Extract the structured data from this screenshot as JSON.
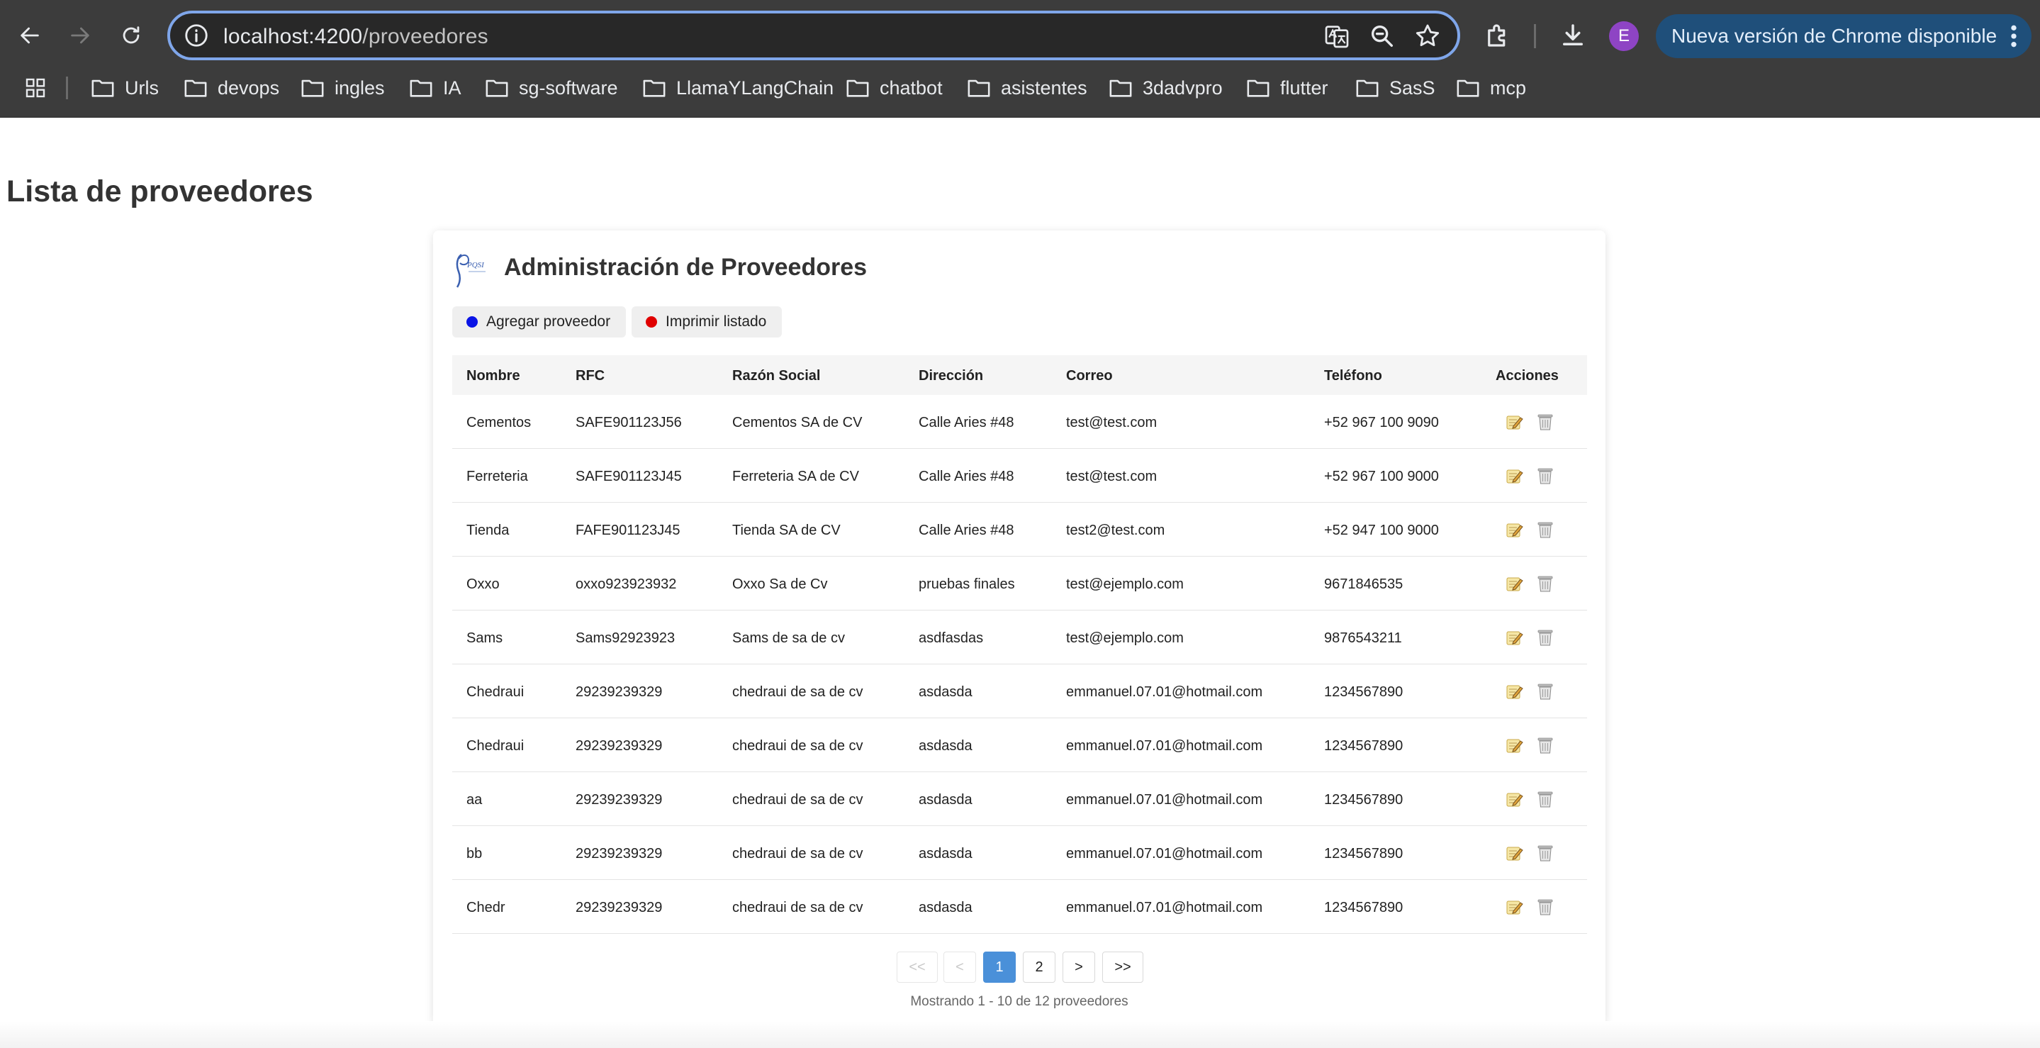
{
  "browser": {
    "url_host": "localhost:4200",
    "url_path": "/proveedores",
    "update_label": "Nueva versión de Chrome disponible",
    "avatar_letter": "E",
    "bookmarks": [
      "Urls",
      "devops",
      "ingles",
      "IA",
      "sg-software",
      "LlamaYLangChain",
      "chatbot",
      "asistentes",
      "3dadvpro",
      "flutter",
      "SasS",
      "mcp"
    ]
  },
  "page": {
    "title": "Lista de proveedores"
  },
  "card": {
    "title": "Administración de Proveedores",
    "logo_text": "PQSI",
    "add_button": "Agregar proveedor",
    "print_button": "Imprimir listado",
    "add_dot_color": "#0a14e6",
    "print_dot_color": "#e00000"
  },
  "table": {
    "headers": [
      "Nombre",
      "RFC",
      "Razón Social",
      "Dirección",
      "Correo",
      "Teléfono",
      "Acciones"
    ],
    "rows": [
      [
        "Cementos",
        "SAFE901123J56",
        "Cementos SA de CV",
        "Calle Aries #48",
        "test@test.com",
        "+52 967 100 9090"
      ],
      [
        "Ferreteria",
        "SAFE901123J45",
        "Ferreteria SA de CV",
        "Calle Aries #48",
        "test@test.com",
        "+52 967 100 9000"
      ],
      [
        "Tienda",
        "FAFE901123J45",
        "Tienda SA de CV",
        "Calle Aries #48",
        "test2@test.com",
        "+52 947 100 9000"
      ],
      [
        "Oxxo",
        "oxxo923923932",
        "Oxxo Sa de Cv",
        "pruebas finales",
        "test@ejemplo.com",
        "9671846535"
      ],
      [
        "Sams",
        "Sams92923923",
        "Sams de sa de cv",
        "asdfasdas",
        "test@ejemplo.com",
        "9876543211"
      ],
      [
        "Chedraui",
        "29239239329",
        "chedraui de sa de cv",
        "asdasda",
        "emmanuel.07.01@hotmail.com",
        "1234567890"
      ],
      [
        "Chedraui",
        "29239239329",
        "chedraui de sa de cv",
        "asdasda",
        "emmanuel.07.01@hotmail.com",
        "1234567890"
      ],
      [
        "aa",
        "29239239329",
        "chedraui de sa de cv",
        "asdasda",
        "emmanuel.07.01@hotmail.com",
        "1234567890"
      ],
      [
        "bb",
        "29239239329",
        "chedraui de sa de cv",
        "asdasda",
        "emmanuel.07.01@hotmail.com",
        "1234567890"
      ],
      [
        "Chedr",
        "29239239329",
        "chedraui de sa de cv",
        "asdasda",
        "emmanuel.07.01@hotmail.com",
        "1234567890"
      ]
    ]
  },
  "pagination": {
    "first": "<<",
    "prev": "<",
    "pages": [
      "1",
      "2"
    ],
    "current_page": "1",
    "next": ">",
    "last": ">>",
    "summary": "Mostrando 1 - 10 de 12 proveedores"
  },
  "colors": {
    "pagination_active": "#4a90d9",
    "update_pill": "#1f4f7a",
    "omnibox_focus": "#7fa6ea"
  }
}
